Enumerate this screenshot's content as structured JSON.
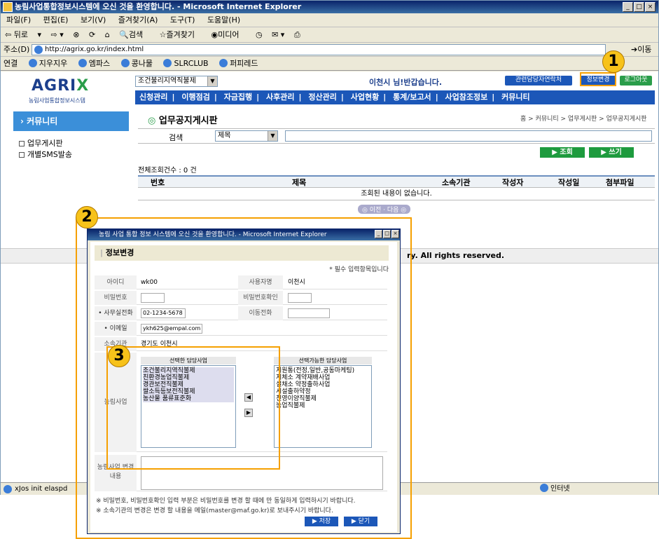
{
  "window": {
    "title": "농림사업통합정보시스템에 오신 것을 환영합니다. - Microsoft Internet Explorer",
    "menu": [
      "파일(F)",
      "편집(E)",
      "보기(V)",
      "즐겨찾기(A)",
      "도구(T)",
      "도움말(H)"
    ],
    "toolbar": [
      "뒤로",
      "검색",
      "즐겨찾기",
      "미디어"
    ],
    "address_label": "주소(D)",
    "address": "http://agrix.go.kr/index.html",
    "go_label": "이동",
    "links_label": "연결",
    "links": [
      "지우지우",
      "엠파스",
      "콩나물",
      "SLRCLUB",
      "퍼피레드"
    ],
    "status": "xJos init elaspd",
    "zone": "인터넷"
  },
  "site": {
    "logo": "AGRI",
    "logo_x": "X",
    "logo_sub": "농림사업통합정보시스템",
    "org_select": "조건불리지역직불제",
    "greeting": "이천시 님!반갑습니다.",
    "top_buttons": [
      "관련담당자연락처",
      "정보변경",
      "로그아웃"
    ],
    "nav": [
      "신청관리",
      "이행점검",
      "자금집행",
      "사후관리",
      "정산관리",
      "사업현황",
      "통계/보고서",
      "사업참조정보",
      "커뮤니티"
    ],
    "side_title": "› 커뮤니티",
    "side_items": [
      "업무게시판",
      "개별SMS발송"
    ],
    "board_title": "업무공지게시판",
    "breadcrumb": "홈 > 커뮤니티 > 업무게시판 > 업무공지게시판",
    "search_label": "검색",
    "search_select": "제목",
    "btn_search": "▶ 조회",
    "btn_write": "▶ 쓰기",
    "total": "전체조회건수 : 0 건",
    "columns": [
      "번호",
      "제목",
      "소속기관",
      "작성자",
      "작성일",
      "첨부파일"
    ],
    "empty_msg": "조회된 내용이 없습니다.",
    "pager": "◎ 이전 · 다음 ◎",
    "rights_text": "ry. All rights reserved."
  },
  "callouts": [
    "1",
    "2",
    "3"
  ],
  "popup": {
    "title": "농림 사업 통합 정보 시스템에 오신 것을 환영합니다. - Microsoft Internet Explorer",
    "heading": "정보변경",
    "required": "* 필수 입력항목입니다",
    "id_label": "아이디",
    "id_value": "wk00",
    "user_label": "사용자명",
    "user_value": "이천시",
    "pw_label": "비밀번호",
    "pw_confirm_label": "비밀번호확인",
    "office_phone_label": "• 사무실전화",
    "office_phone_value": "02-1234-5678",
    "mobile_label": "이동전화",
    "email_label": "• 이메일",
    "email_value": "ykh625@empal.com",
    "org_label": "소속기관",
    "org_value": "경기도 이천시",
    "biz_label": "농림사업",
    "selected_title": "선택한 담당사업",
    "selected_items": [
      "조건불리지역직불제",
      "친환경농업직불제",
      "경관보전직불제",
      "쌀소득등보전직불제",
      "농산물 품류표준화"
    ],
    "available_title": "선택가능한 담당사업",
    "available_items": [
      "지원통(전정,일반,공동마케팅)",
      "지체소 계약재배사업",
      "설채소 약정출하사업",
      "시설출하약정",
      "친영이양직불제",
      "농업직불제"
    ],
    "change_label": "농림사업 변경내용",
    "note1": "※ 비밀번호, 비밀번호확인 입력 부분은 비밀번호를 변경 할 때에 만 동일하게 입력하시기 바랍니다.",
    "note2": "※ 소속기관의 변경은 변경 할 내용을 메일(master@maf.go.kr)로 보내주시기 바랍니다.",
    "btn_save": "▶ 저장",
    "btn_close": "▶ 닫기"
  }
}
